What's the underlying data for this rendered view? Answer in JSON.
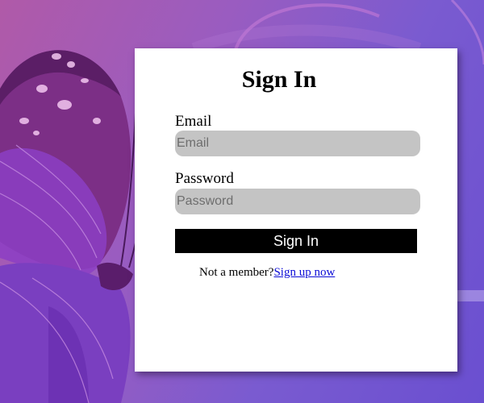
{
  "colors": {
    "background_from": "#b05aa8",
    "background_to": "#6a4fd0",
    "card": "#ffffff",
    "field": "#c4c4c4",
    "button": "#000000",
    "link": "#0b0bd6"
  },
  "background": {
    "image": "butterfly-illustration"
  },
  "signin": {
    "title": "Sign In",
    "email_label": "Email",
    "email_placeholder": "Email",
    "password_label": "Password",
    "password_placeholder": "Password",
    "submit_label": "Sign In",
    "footer_text": "Not a member?",
    "signup_link": "Sign up now"
  }
}
